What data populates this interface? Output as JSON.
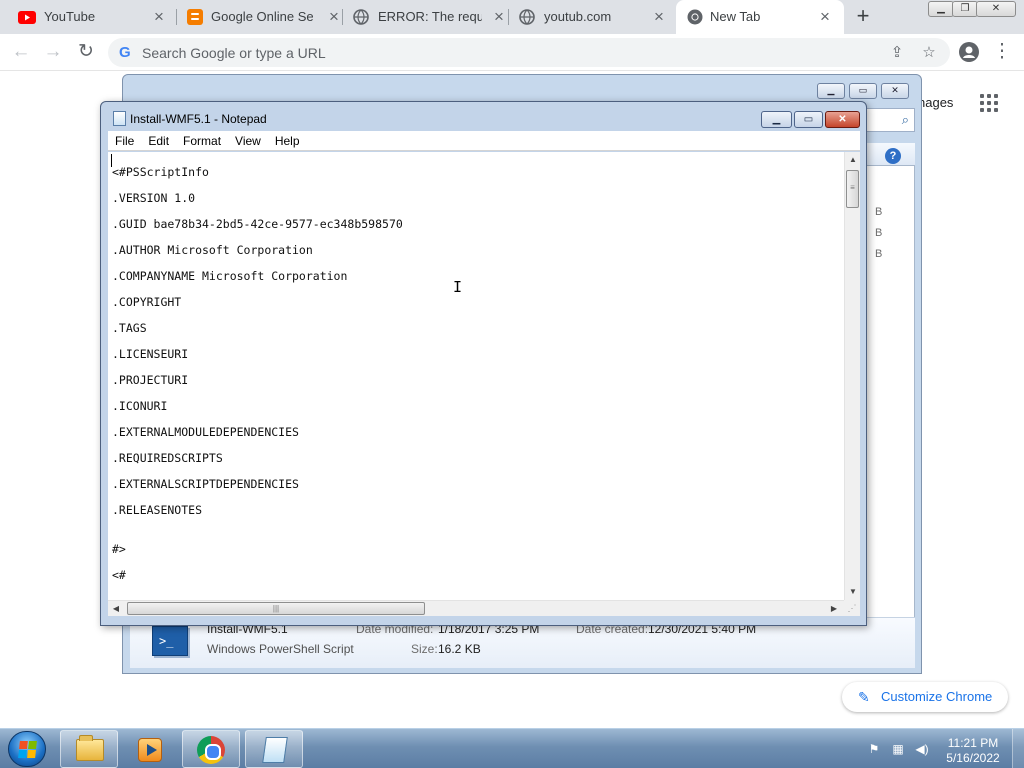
{
  "chrome": {
    "tabs": [
      {
        "title": "YouTube",
        "icon": "youtube-icon",
        "active": false
      },
      {
        "title": "Google Online Secu",
        "icon": "blogger-icon",
        "active": false
      },
      {
        "title": "ERROR: The reques",
        "icon": "globe-icon",
        "active": false
      },
      {
        "title": "youtub.com",
        "icon": "globe-icon",
        "active": false
      },
      {
        "title": "New Tab",
        "icon": "chrome-icon",
        "active": true
      }
    ],
    "new_tab_symbol": "+",
    "close_symbol": "×",
    "omnibox": {
      "placeholder": "Search Google or type a URL",
      "g_letter": "G"
    },
    "page": {
      "images_link_fragment": "nages",
      "customize_label": "Customize Chrome"
    }
  },
  "explorer": {
    "column_fragments": [
      "B",
      "B",
      "B"
    ],
    "details": {
      "file_name": "Install-WMF5.1",
      "file_type": "Windows PowerShell Script",
      "date_modified_label": "Date modified:",
      "date_modified_value": "1/18/2017 3:25 PM",
      "date_created_label": "Date created:",
      "date_created_value": "12/30/2021 5:40 PM",
      "size_label": "Size:",
      "size_value": "16.2 KB"
    }
  },
  "notepad": {
    "title": "Install-WMF5.1 - Notepad",
    "menu": [
      "File",
      "Edit",
      "Format",
      "View",
      "Help"
    ],
    "lines": [
      "<#PSScriptInfo",
      ".VERSION 1.0",
      ".GUID bae78b34-2bd5-42ce-9577-ec348b598570",
      ".AUTHOR Microsoft Corporation",
      ".COMPANYNAME Microsoft Corporation",
      ".COPYRIGHT",
      ".TAGS",
      ".LICENSEURI",
      ".PROJECTURI",
      ".ICONURI",
      ".EXTERNALMODULEDEPENDENCIES",
      ".REQUIREDSCRIPTS",
      ".EXTERNALSCRIPTDEPENDENCIES",
      ".RELEASENOTES",
      "#>",
      "<#"
    ]
  },
  "taskbar": {
    "pinned": [
      "windows-explorer-icon",
      "media-player-icon",
      "chrome-icon",
      "notepad-icon"
    ],
    "clock_time": "11:21 PM",
    "clock_date": "5/16/2022"
  },
  "colors": {
    "chrome_tabstrip": "#dee1e6",
    "youtube_red": "#ff0000",
    "blogger_orange": "#f57d00",
    "chrome_blue": "#1a73e8",
    "notepad_frame": "#c3d4e9",
    "taskbar_blue": "#6f8fb2"
  }
}
